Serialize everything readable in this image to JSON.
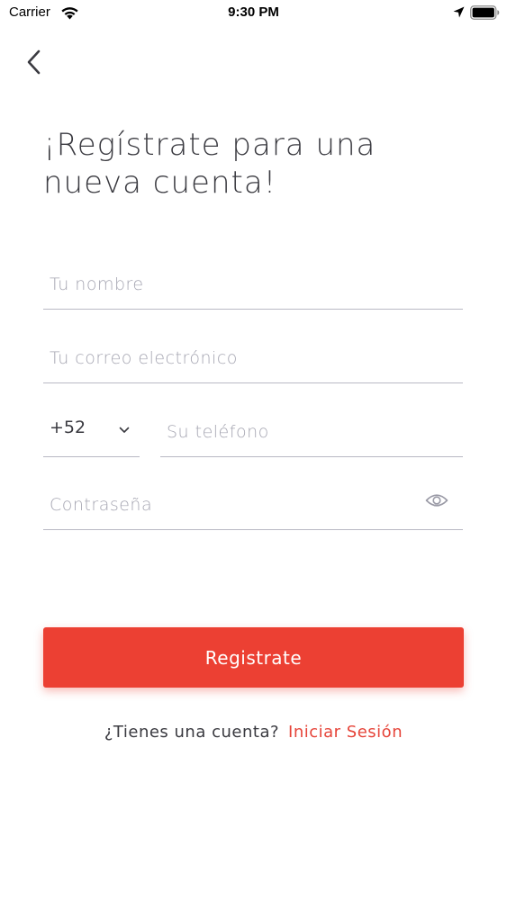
{
  "status_bar": {
    "carrier": "Carrier",
    "time": "9:30 PM"
  },
  "icons": {
    "back": "chevron-left-icon",
    "wifi": "wifi-icon",
    "location": "location-arrow-icon",
    "battery": "battery-icon",
    "dropdown": "chevron-down-icon",
    "visibility": "eye-icon"
  },
  "title": {
    "line1": "¡Regístrate para una",
    "line2": "nueva cuenta!"
  },
  "form": {
    "name_placeholder": "Tu nombre",
    "email_placeholder": "Tu correo electrónico",
    "country_code": "+52",
    "phone_placeholder": "Su teléfono",
    "password_placeholder": "Contraseña"
  },
  "register_button_label": "Registrate",
  "footer": {
    "question": "¿Tienes una cuenta?",
    "login_link": "Iniciar Sesión"
  },
  "colors": {
    "accent": "#ec4033",
    "text": "#3a3a40",
    "placeholder": "#a6a6b2",
    "underline": "#b9b9c4"
  }
}
